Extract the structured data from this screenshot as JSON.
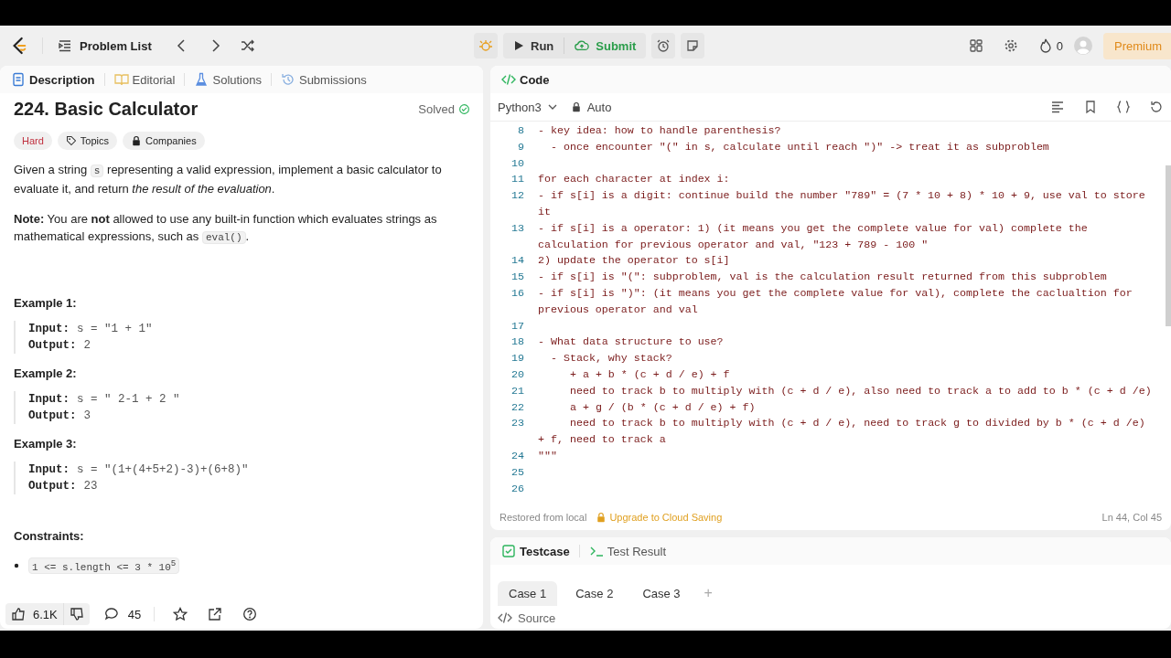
{
  "topbar": {
    "problem_list": "Problem List",
    "run": "Run",
    "submit": "Submit",
    "streak": "0",
    "premium": "Premium"
  },
  "left_tabs": [
    {
      "label": "Description",
      "selected": true
    },
    {
      "label": "Editorial",
      "selected": false
    },
    {
      "label": "Solutions",
      "selected": false
    },
    {
      "label": "Submissions",
      "selected": false
    }
  ],
  "problem": {
    "title": "224. Basic Calculator",
    "status": "Solved",
    "solved": true,
    "tags": [
      {
        "label": "Hard",
        "kind": "difficulty"
      },
      {
        "label": "Topics",
        "kind": "tag"
      },
      {
        "label": "Companies",
        "kind": "lock"
      }
    ],
    "paragraphs": [
      [
        {
          "text": "Given a string ",
          "code": false
        },
        {
          "text": "s",
          "code": true
        },
        {
          "text": " representing a valid expression, implement a basic calculator to evaluate it, and return *the result of the evaluation*.",
          "code": false
        }
      ],
      [
        {
          "text": "**Note:** You are **not** allowed to use any built-in function which evaluates strings as mathematical expressions, such as ",
          "code": false
        },
        {
          "text": "eval()",
          "code": true
        },
        {
          "text": ".",
          "code": false
        }
      ]
    ],
    "examples": [
      {
        "title": "Example 1:",
        "input_label": "Input:",
        "input": "s = \"1 + 1\"",
        "output_label": "Output:",
        "output": "2"
      },
      {
        "title": "Example 2:",
        "input_label": "Input:",
        "input": "s = \" 2-1 + 2 \"",
        "output_label": "Output:",
        "output": "3"
      },
      {
        "title": "Example 3:",
        "input_label": "Input:",
        "input": "s = \"(1+(4+5+2)-3)+(6+8)\"",
        "output_label": "Output:",
        "output": "23"
      }
    ],
    "constraints_title": "Constraints:",
    "constraints": [
      "1 <= s.length <= 3 * 10$^{5}$"
    ]
  },
  "footer": {
    "likes": "6.1K",
    "comments": "45"
  },
  "code_panel": {
    "title": "Code",
    "language": "Python3",
    "mode": "Auto",
    "lines": [
      {
        "number": "8",
        "text": "- key idea: how to handle parenthesis?"
      },
      {
        "number": "9",
        "text": "  - once encounter \"(\" in s, calculate until reach \")\" -> treat it as subproblem"
      },
      {
        "number": "10"
      },
      {
        "number": "11",
        "text": "for each character at index i:"
      },
      {
        "number": "12",
        "text": "- if s[i] is a digit: continue build the number \"789\" = (7 * 10 + 8) * 10 + 9, use val to store it"
      },
      {
        "number": "13",
        "text": "- if s[i] is a operator: 1) (it means you get the complete value for val) complete the calculation for previous operator and val, \"123 + 789 - 100 \""
      },
      {
        "number": "14",
        "text": "2) update the operator to s[i]"
      },
      {
        "number": "15",
        "text": "- if s[i] is \"(\": subproblem, val is the calculation result returned from this subproblem"
      },
      {
        "number": "16",
        "text": "- if s[i] is \")\": (it means you get the complete value for val), complete the caclualtion for previous operator and val"
      },
      {
        "number": "17"
      },
      {
        "number": "18",
        "text": "- What data structure to use?"
      },
      {
        "number": "19",
        "text": "  - Stack, why stack?"
      },
      {
        "number": "20",
        "text": "     + a + b * (c + d / e) + f"
      },
      {
        "number": "21",
        "text": "     need to track b to multiply with (c + d / e), also need to track a to add to b * (c + d /e)"
      },
      {
        "number": "22",
        "text": "     a + g / (b * (c + d / e) + f)"
      },
      {
        "number": "23",
        "text": "     need to track b to multiply with (c + d / e), need to track g to divided by b * (c + d /e) + f, need to track a"
      },
      {
        "number": "24",
        "text": "\"\"\""
      },
      {
        "number": "25"
      },
      {
        "number": "26"
      }
    ],
    "restored": "Restored from local",
    "upgrade": "Upgrade to Cloud Saving",
    "cursor": "Ln 44, Col 45"
  },
  "test_panel": {
    "tabs": [
      {
        "label": "Testcase",
        "selected": true
      },
      {
        "label": "Test Result",
        "selected": false
      }
    ],
    "cases": [
      {
        "label": "Case 1",
        "selected": true
      },
      {
        "label": "Case 2",
        "selected": false
      },
      {
        "label": "Case 3",
        "selected": false
      }
    ],
    "add": "+",
    "source": "Source"
  }
}
